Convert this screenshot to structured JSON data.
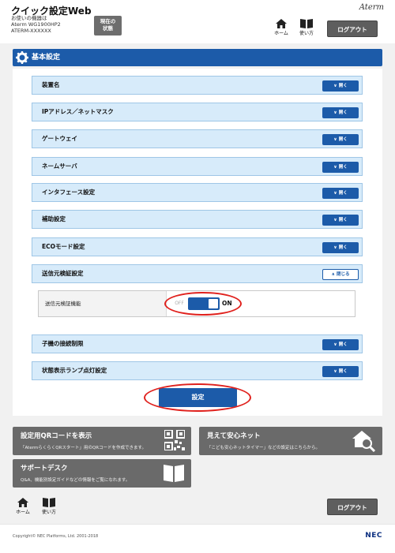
{
  "header": {
    "title": "クイック設定Web",
    "device_lines": [
      "お使いの機器は",
      "Aterm WG1900HP2",
      "ATERM-XXXXXX"
    ],
    "status_button": [
      "現在の",
      "状態"
    ],
    "brand": "Aterm",
    "home_label": "ホーム",
    "manual_label": "使い方",
    "logout_label": "ログアウト"
  },
  "section": {
    "title": "基本設定"
  },
  "rows": [
    {
      "label": "装置名",
      "button": "開く"
    },
    {
      "label": "IPアドレス／ネットマスク",
      "button": "開く"
    },
    {
      "label": "ゲートウェイ",
      "button": "開く"
    },
    {
      "label": "ネームサーバ",
      "button": "開く"
    },
    {
      "label": "インタフェース設定",
      "button": "開く"
    },
    {
      "label": "補助設定",
      "button": "開く"
    },
    {
      "label": "ECOモード設定",
      "button": "開く"
    },
    {
      "label": "送信元検証設定",
      "button": "閉じる"
    },
    {
      "label": "子機の接続制限",
      "button": "開く"
    },
    {
      "label": "状態表示ランプ点灯設定",
      "button": "開く"
    }
  ],
  "source_verify": {
    "label": "送信元検証機能",
    "off_text": "OFF",
    "on_text": "ON",
    "state": "ON"
  },
  "submit_label": "設定",
  "cards": {
    "qr": {
      "title": "設定用QRコードを表示",
      "desc": "「AtermらくらくQRスタート」用のQRコードを作成できます。"
    },
    "safety": {
      "title": "見えて安心ネット",
      "desc": "「こども安心ネットタイマー」などの設定はこちらから。"
    },
    "support": {
      "title": "サポートデスク",
      "desc": "Q&A、機能別設定ガイドなどの情報をご覧になれます。"
    }
  },
  "footer": {
    "home_label": "ホーム",
    "manual_label": "使い方",
    "logout_label": "ログアウト",
    "copyright": "Copyright© NEC Platforms, Ltd. 2001-2018",
    "logo": "NEC"
  },
  "colors": {
    "accent": "#1c5ba9",
    "row_bg": "#d7ebfa",
    "highlight": "#e0211d",
    "card_bg": "#6a6a6a"
  }
}
